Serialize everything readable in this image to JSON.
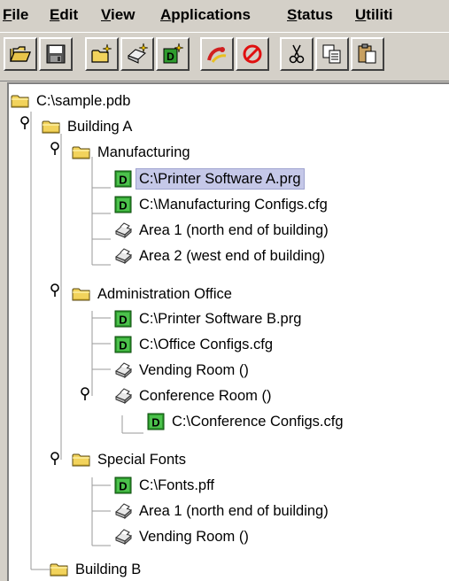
{
  "menu": {
    "items": [
      {
        "label": "File"
      },
      {
        "label": "Edit"
      },
      {
        "label": "View"
      },
      {
        "label": "Applications"
      },
      {
        "label": "Status"
      },
      {
        "label": "Utiliti"
      }
    ]
  },
  "toolbar": {
    "buttons": [
      {
        "icon": "open-folder-icon"
      },
      {
        "icon": "save-icon"
      },
      {
        "icon": "new-folder-icon"
      },
      {
        "icon": "new-printer-icon"
      },
      {
        "icon": "new-document-icon"
      },
      {
        "icon": "connect-icon"
      },
      {
        "icon": "stop-icon"
      },
      {
        "icon": "cut-icon"
      },
      {
        "icon": "copy-icon"
      },
      {
        "icon": "paste-icon"
      }
    ]
  },
  "tree": {
    "root": "C:\\sample.pdb",
    "building_a": "Building A",
    "manufacturing": "Manufacturing",
    "mfg_printer_sw": "C:\\Printer Software A.prg",
    "mfg_configs": "C:\\Manufacturing Configs.cfg",
    "mfg_area1": "Area 1 (north end of building)",
    "mfg_area2": "Area 2 (west end of building)",
    "admin_office": "Administration Office",
    "admin_printer_sw": "C:\\Printer Software B.prg",
    "admin_configs": "C:\\Office Configs.cfg",
    "admin_vending": "Vending Room ()",
    "admin_conference": "Conference Room ()",
    "conf_configs": "C:\\Conference Configs.cfg",
    "special_fonts": "Special Fonts",
    "fonts_file": "C:\\Fonts.pff",
    "fonts_area1": "Area 1 (north end of building)",
    "fonts_vending": "Vending Room ()",
    "building_b": "Building B"
  },
  "colors": {
    "selection": "#c5c8e8",
    "folder": "#f2d35c",
    "document_badge": "#2e9b2e"
  }
}
